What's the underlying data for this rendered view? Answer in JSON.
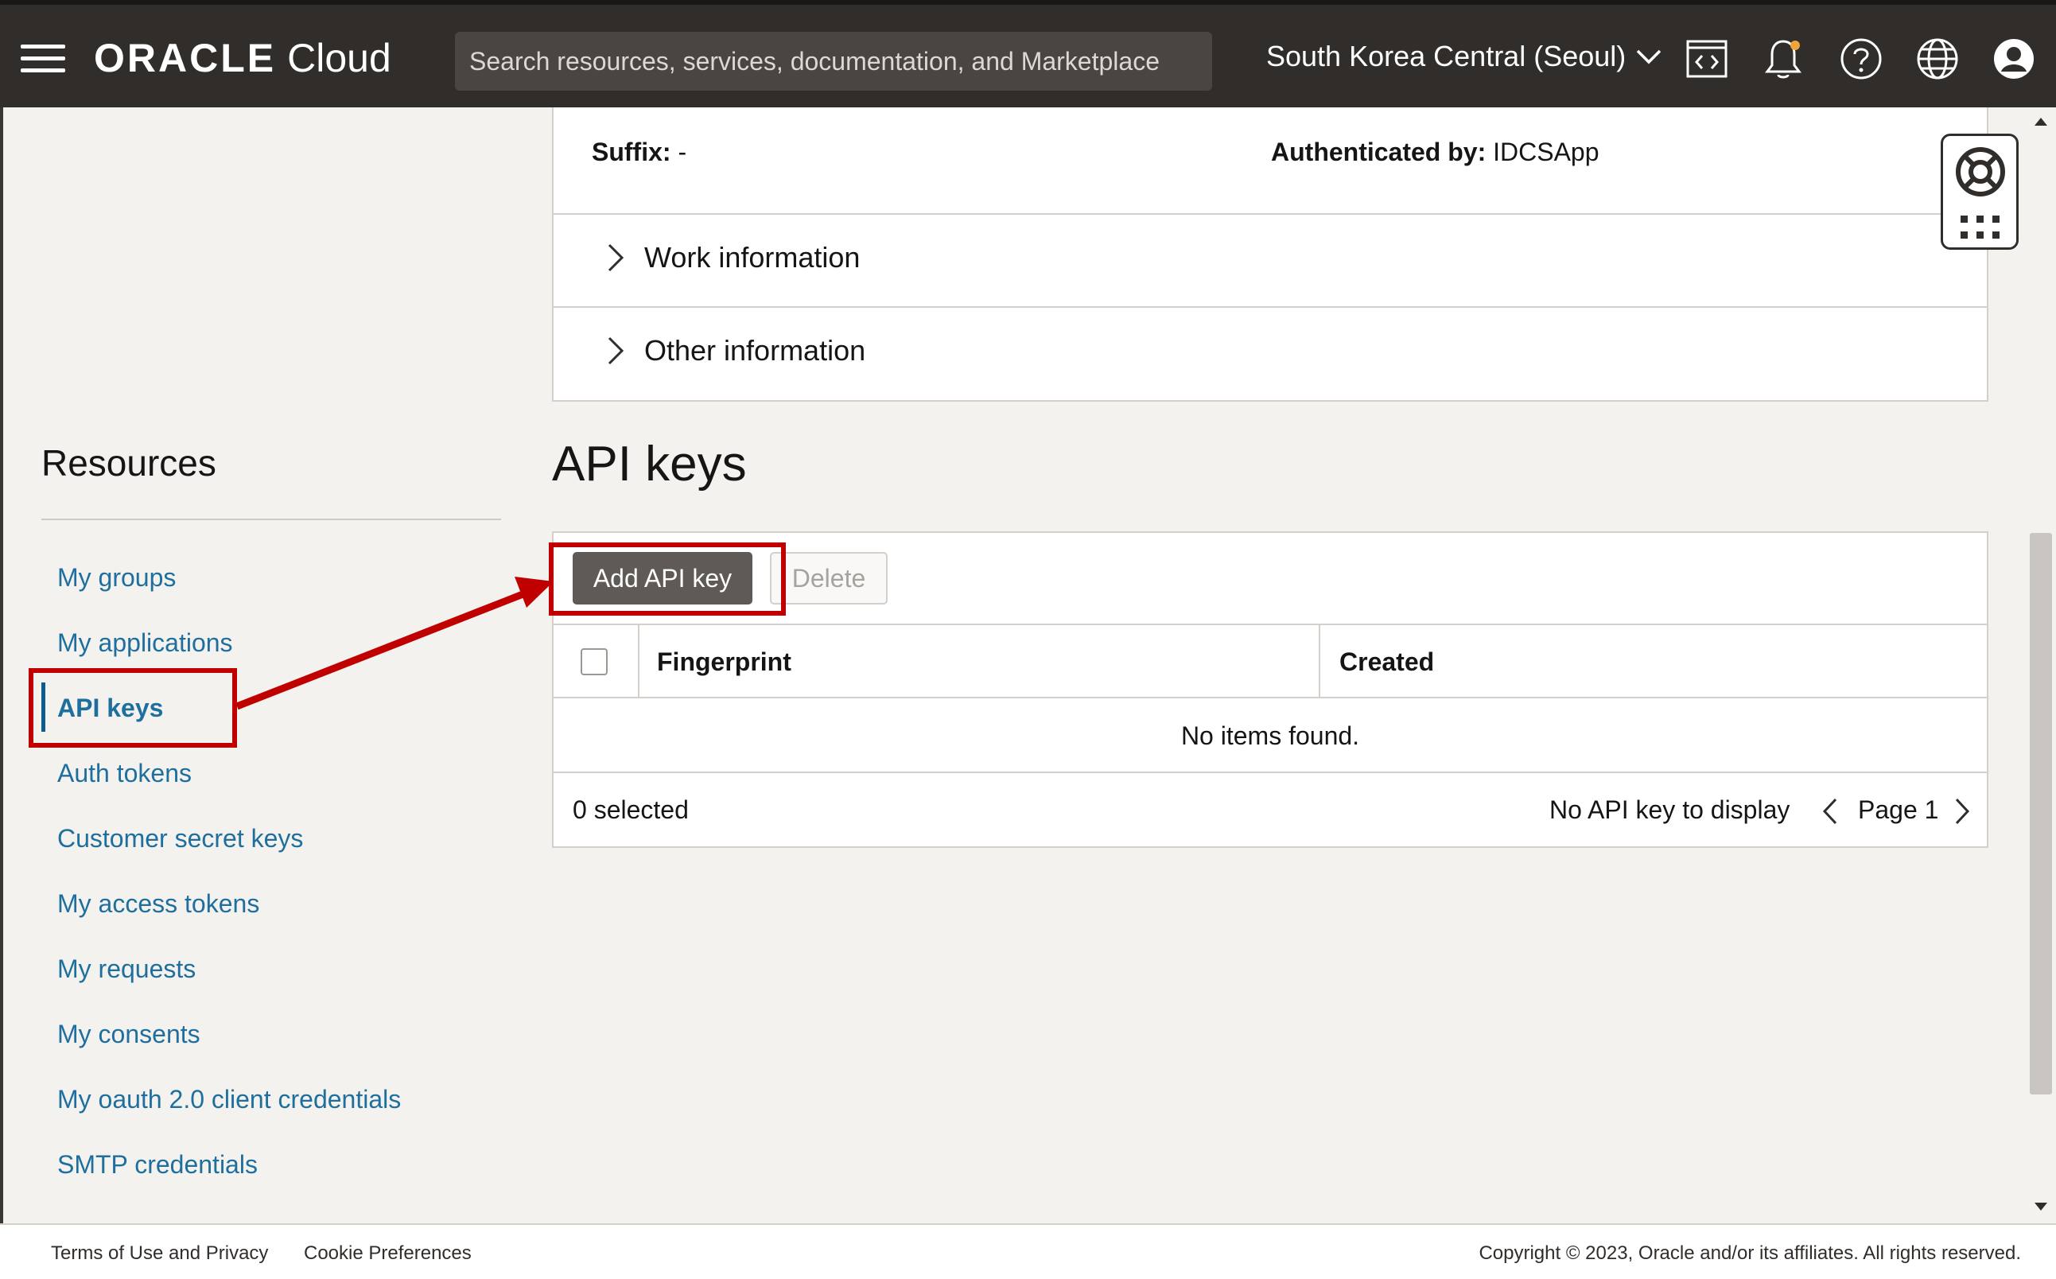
{
  "topbar": {
    "brand_oracle": "ORACLE",
    "brand_cloud": "Cloud",
    "search_placeholder": "Search resources, services, documentation, and Marketplace",
    "region": "South Korea Central (Seoul)"
  },
  "details": {
    "suffix_label": "Suffix:",
    "suffix_value": "-",
    "auth_label": "Authenticated by:",
    "auth_value": "IDCSApp",
    "sections": [
      "Work information",
      "Other information"
    ]
  },
  "resources": {
    "title": "Resources",
    "items": [
      {
        "label": "My groups",
        "active": false
      },
      {
        "label": "My applications",
        "active": false
      },
      {
        "label": "API keys",
        "active": true
      },
      {
        "label": "Auth tokens",
        "active": false
      },
      {
        "label": "Customer secret keys",
        "active": false
      },
      {
        "label": "My access tokens",
        "active": false
      },
      {
        "label": "My requests",
        "active": false
      },
      {
        "label": "My consents",
        "active": false
      },
      {
        "label": "My oauth 2.0 client credentials",
        "active": false
      },
      {
        "label": "SMTP credentials",
        "active": false
      }
    ]
  },
  "api_keys": {
    "title": "API keys",
    "add_button": "Add API key",
    "delete_button": "Delete",
    "columns": [
      "Fingerprint",
      "Created"
    ],
    "empty_text": "No items found.",
    "selected_text": "0 selected",
    "no_display_text": "No API key to display",
    "page_label": "Page 1"
  },
  "footer": {
    "terms": "Terms of Use and Privacy",
    "cookies": "Cookie Preferences",
    "copyright": "Copyright © 2023, Oracle and/or its affiliates. All rights reserved."
  },
  "colors": {
    "topbar": "#312d2a",
    "link": "#1f6f9e",
    "annotation": "#c00000",
    "primary_button": "#5f5a55"
  }
}
